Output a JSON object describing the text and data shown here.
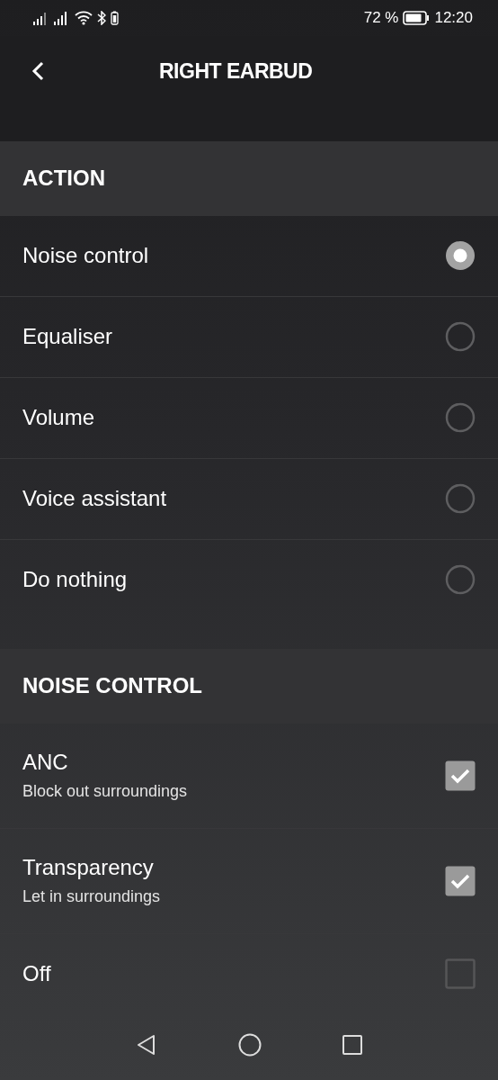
{
  "status_bar": {
    "battery": "72 %",
    "time": "12:20"
  },
  "header": {
    "title": "RIGHT EARBUD"
  },
  "sections": [
    {
      "title": "ACTION",
      "kind": "radio",
      "items": [
        {
          "label": "Noise control",
          "selected": true
        },
        {
          "label": "Equaliser",
          "selected": false
        },
        {
          "label": "Volume",
          "selected": false
        },
        {
          "label": "Voice assistant",
          "selected": false
        },
        {
          "label": "Do nothing",
          "selected": false
        }
      ]
    },
    {
      "title": "NOISE CONTROL",
      "kind": "check",
      "items": [
        {
          "label": "ANC",
          "subtitle": "Block out surroundings",
          "checked": true
        },
        {
          "label": "Transparency",
          "subtitle": "Let in surroundings",
          "checked": true
        },
        {
          "label": "Off",
          "checked": false
        }
      ]
    }
  ]
}
